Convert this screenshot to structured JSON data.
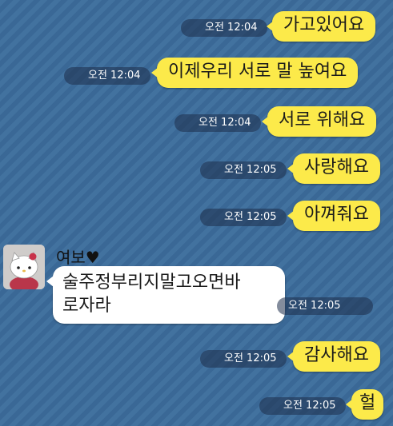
{
  "messages_out": [
    {
      "text": "가고있어요",
      "time": "오전 12:04"
    },
    {
      "text": "이제우리 서로 말 높여요",
      "time": "오전 12:04"
    },
    {
      "text": "서로 위해요",
      "time": "오전 12:04"
    },
    {
      "text": "사랑해요",
      "time": "오전 12:05"
    },
    {
      "text": "아껴줘요",
      "time": "오전 12:05"
    }
  ],
  "incoming": {
    "sender": "여보♥",
    "text_line1": "술주정부리지말고오면바",
    "text_line2": "로자라",
    "time": "오전 12:05",
    "avatar_icon": "hello-kitty-avatar-icon"
  },
  "messages_out_after": [
    {
      "text": "감사해요",
      "time": "오전 12:05"
    },
    {
      "text": "헐",
      "time": "오전 12:05"
    }
  ],
  "colors": {
    "background": "#3f6ea0",
    "outgoing_bubble": "#fcea4a",
    "incoming_bubble": "#ffffff"
  }
}
